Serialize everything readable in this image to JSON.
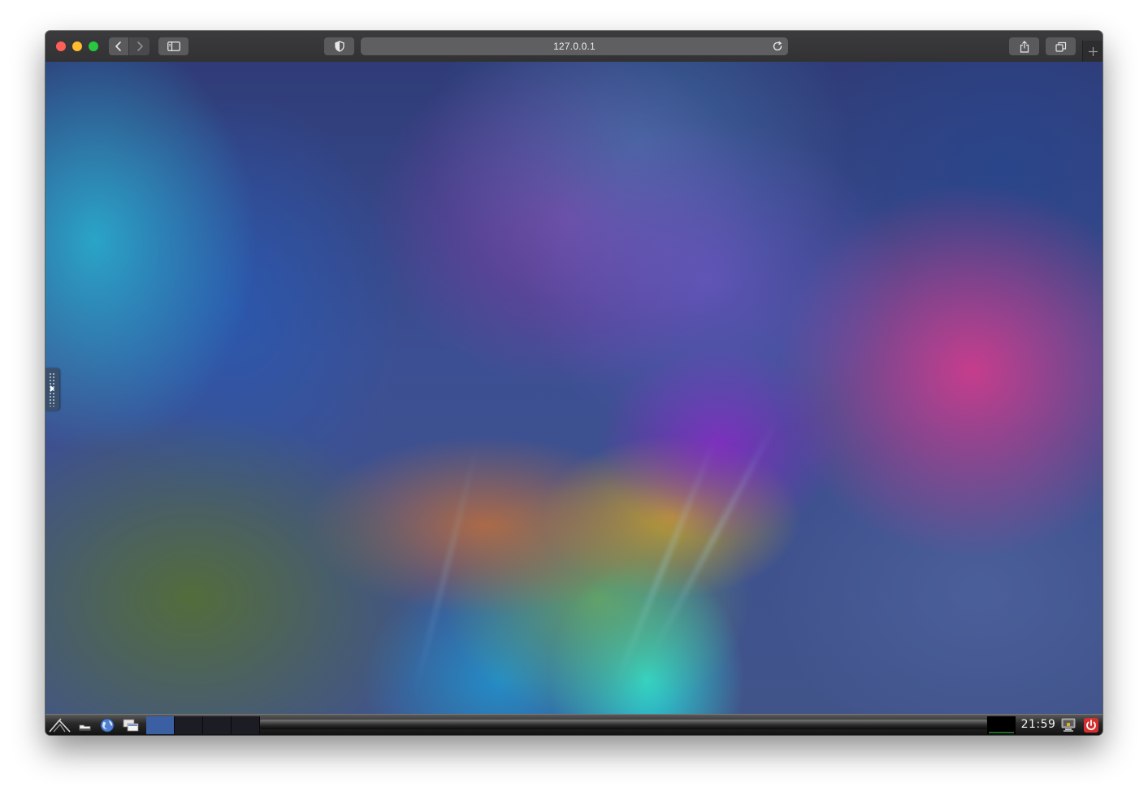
{
  "browser": {
    "url": "127.0.0.1",
    "icons": {
      "close": "close-dot",
      "minimize": "minimize-dot",
      "maximize": "maximize-dot",
      "back": "chevron-left-icon",
      "forward": "chevron-right-icon",
      "sidebar": "sidebar-icon",
      "privacy": "shield-icon",
      "reload": "reload-icon",
      "share": "share-icon",
      "tabs": "tab-overview-icon",
      "new_tab": "plus-icon"
    },
    "colors": {
      "close": "#fe5f57",
      "minimize": "#febc2e",
      "maximize": "#28c840",
      "toolbar": "#323234"
    }
  },
  "desktop": {
    "side_panel_icon": "play-arrow-icon"
  },
  "taskbar": {
    "launchers": [
      {
        "name": "menu",
        "icon": "app-menu-logo-icon"
      },
      {
        "name": "files",
        "icon": "file-manager-icon"
      },
      {
        "name": "web",
        "icon": "web-browser-icon"
      },
      {
        "name": "desktops",
        "icon": "show-desktop-icon"
      }
    ],
    "workspaces": [
      {
        "index": 1,
        "active": true
      },
      {
        "index": 2,
        "active": false
      },
      {
        "index": 3,
        "active": false
      },
      {
        "index": 4,
        "active": false
      }
    ],
    "clock": "21:59",
    "tray_icons": [
      "network-icon",
      "power-icon"
    ],
    "colors": {
      "active_workspace": "#3b5fa3",
      "power": "#d32f2f"
    }
  }
}
